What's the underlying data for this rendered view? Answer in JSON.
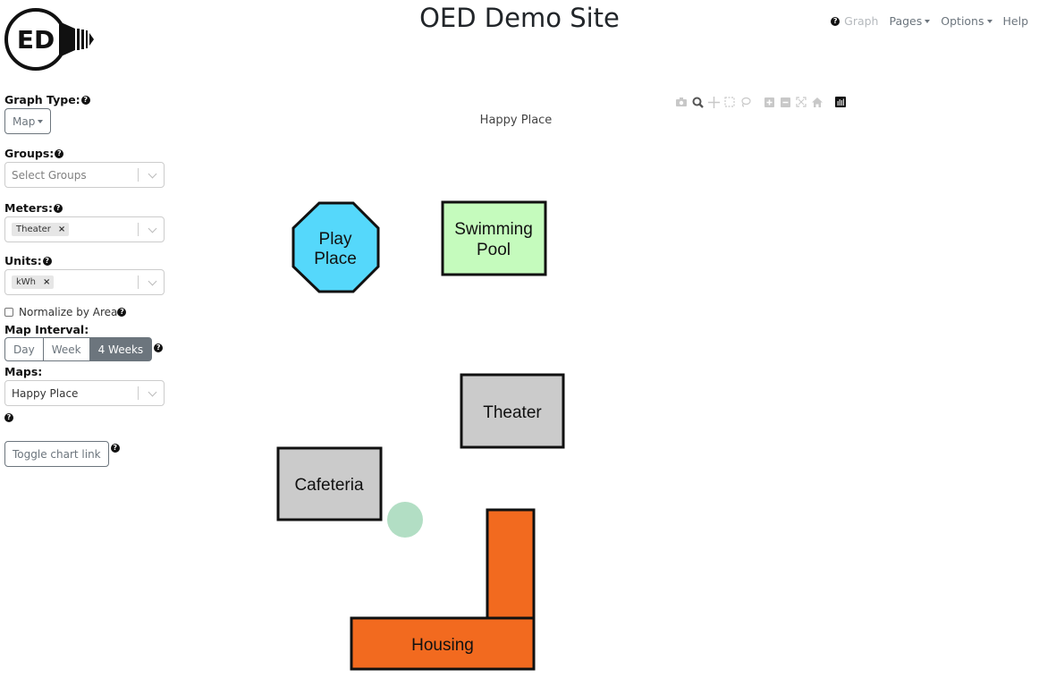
{
  "header": {
    "site_title": "OED Demo Site",
    "logo_text": "ED",
    "nav": [
      {
        "label": "Graph",
        "icon": "help-circle-icon",
        "disabled": true
      },
      {
        "label": "Pages",
        "dropdown": true
      },
      {
        "label": "Options",
        "dropdown": true
      },
      {
        "label": "Help"
      }
    ]
  },
  "sidebar": {
    "graph_type": {
      "label": "Graph Type:",
      "value": "Map"
    },
    "groups": {
      "label": "Groups:",
      "placeholder": "Select Groups"
    },
    "meters": {
      "label": "Meters:",
      "selected": [
        "Theater"
      ]
    },
    "units": {
      "label": "Units:",
      "selected": [
        "kWh"
      ]
    },
    "normalize": {
      "label": "Normalize by Area",
      "checked": false
    },
    "map_interval": {
      "label": "Map Interval:",
      "options": [
        "Day",
        "Week",
        "4 Weeks"
      ],
      "active": "4 Weeks"
    },
    "maps": {
      "label": "Maps:",
      "value": "Happy Place"
    },
    "toggle_chart_link": "Toggle chart link",
    "remove_glyph": "×",
    "help_glyph": "?"
  },
  "modebar": {
    "icons": [
      "camera-icon",
      "zoom-icon",
      "pan-icon",
      "box-select-icon",
      "lasso-select-icon",
      "zoom-in-icon",
      "zoom-out-icon",
      "autoscale-icon",
      "reset-axes-icon",
      "plotly-logo-icon"
    ]
  },
  "map": {
    "title": "Happy Place",
    "colors": {
      "play_place": "#55d8fb",
      "swimming_pool": "#c5fbbd",
      "theater": "#cbcbcb",
      "cafeteria": "#cbcbcb",
      "housing": "#f26a1f",
      "meter_marker": "#b2dec4",
      "outline": "#111111"
    },
    "buildings": [
      {
        "name": "play-place",
        "label_lines": [
          "Play",
          "Place"
        ]
      },
      {
        "name": "swimming-pool",
        "label_lines": [
          "Swimming",
          "Pool"
        ]
      },
      {
        "name": "theater",
        "label_lines": [
          "Theater"
        ]
      },
      {
        "name": "cafeteria",
        "label_lines": [
          "Cafeteria"
        ]
      },
      {
        "name": "housing",
        "label_lines": [
          "Housing"
        ]
      }
    ],
    "markers": [
      {
        "meter": "Theater"
      }
    ]
  }
}
